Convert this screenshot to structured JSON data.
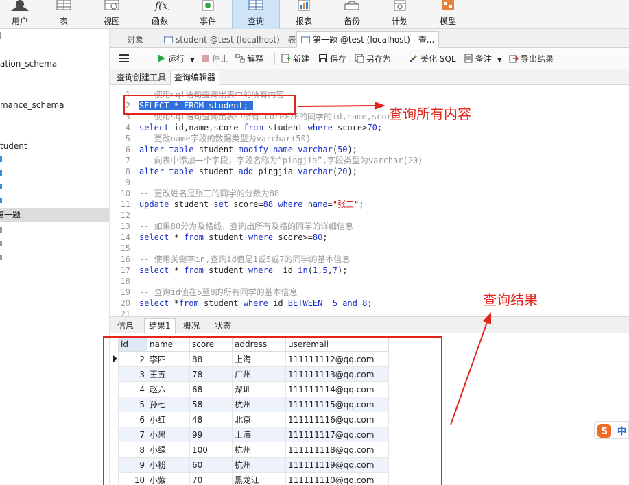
{
  "ribbon": {
    "items": [
      {
        "label": "用户",
        "icon": "user-icon"
      },
      {
        "label": "表",
        "icon": "table-icon"
      },
      {
        "label": "视图",
        "icon": "view-icon"
      },
      {
        "label": "函数",
        "icon": "function-icon"
      },
      {
        "label": "事件",
        "icon": "event-icon"
      },
      {
        "label": "查询",
        "icon": "query-icon",
        "active": true
      },
      {
        "label": "报表",
        "icon": "report-icon"
      },
      {
        "label": "备份",
        "icon": "backup-icon"
      },
      {
        "label": "计划",
        "icon": "schedule-icon"
      },
      {
        "label": "模型",
        "icon": "model-icon"
      }
    ]
  },
  "tree": {
    "items": [
      "ation_schema",
      "mance_schema",
      "tudent",
      "第一题"
    ]
  },
  "tabs": {
    "objects": "对象",
    "table_tab": "student @test (localhost) - 表",
    "query_tab": "第一题 @test (localhost) - 查..."
  },
  "toolbar": {
    "run": "运行",
    "stop": "停止",
    "explain": "解释",
    "new": "新建",
    "save": "保存",
    "save_as": "另存为",
    "beautify": "美化 SQL",
    "note": "备注",
    "export": "导出结果"
  },
  "subtabs": {
    "builder": "查询创建工具",
    "editor": "查询编辑器"
  },
  "editor": {
    "lines": [
      {
        "n": "1",
        "parts": [
          [
            "cm",
            "-- 使用sql语句查询出表中的所有内容"
          ]
        ]
      },
      {
        "n": "2",
        "parts": [
          [
            "hl",
            "SELECT * FROM student; "
          ]
        ]
      },
      {
        "n": "3",
        "parts": [
          [
            "cm",
            "-- 使用sql语句查询出表中所有score>70的同学的id,name,score"
          ]
        ]
      },
      {
        "n": "4",
        "parts": [
          [
            "kw",
            "select"
          ],
          [
            "",
            " id,name,score "
          ],
          [
            "kw",
            "from"
          ],
          [
            "",
            " student "
          ],
          [
            "kw",
            "where"
          ],
          [
            "",
            " score>"
          ],
          [
            "num",
            "70"
          ],
          [
            "",
            ";"
          ]
        ]
      },
      {
        "n": "5",
        "parts": [
          [
            "cm",
            "-- 更改name字段的数据类型为varchar(50)"
          ]
        ]
      },
      {
        "n": "6",
        "parts": [
          [
            "kw",
            "alter table"
          ],
          [
            "",
            " student "
          ],
          [
            "kw",
            "modify"
          ],
          [
            "",
            " "
          ],
          [
            "kw",
            "name"
          ],
          [
            "",
            " "
          ],
          [
            "kw",
            "varchar"
          ],
          [
            "",
            "("
          ],
          [
            "num",
            "50"
          ],
          [
            "",
            ");"
          ]
        ]
      },
      {
        "n": "7",
        "parts": [
          [
            "cm",
            "-- 向表中添加一个字段，字段名称为“pingjia”,字段类型为varchar(20)"
          ]
        ]
      },
      {
        "n": "8",
        "parts": [
          [
            "kw",
            "alter table"
          ],
          [
            "",
            " student "
          ],
          [
            "kw",
            "add"
          ],
          [
            "",
            " pingjia "
          ],
          [
            "kw",
            "varchar"
          ],
          [
            "",
            "("
          ],
          [
            "num",
            "20"
          ],
          [
            "",
            ");"
          ]
        ]
      },
      {
        "n": "9",
        "parts": []
      },
      {
        "n": "10",
        "parts": [
          [
            "cm",
            "-- 更改姓名是张三的同学的分数为88"
          ]
        ]
      },
      {
        "n": "11",
        "parts": [
          [
            "kw",
            "update"
          ],
          [
            "",
            " student "
          ],
          [
            "kw",
            "set"
          ],
          [
            "",
            " score="
          ],
          [
            "num",
            "88"
          ],
          [
            "",
            " "
          ],
          [
            "kw",
            "where"
          ],
          [
            "",
            " "
          ],
          [
            "kw",
            "name"
          ],
          [
            "",
            "="
          ],
          [
            "str",
            "\"张三\""
          ],
          [
            "",
            ";"
          ]
        ]
      },
      {
        "n": "12",
        "parts": []
      },
      {
        "n": "13",
        "parts": [
          [
            "cm",
            "-- 如果80分为及格线，查询出所有及格的同学的详细信息"
          ]
        ]
      },
      {
        "n": "14",
        "parts": [
          [
            "kw",
            "select"
          ],
          [
            "",
            " * "
          ],
          [
            "kw",
            "from"
          ],
          [
            "",
            " student "
          ],
          [
            "kw",
            "where"
          ],
          [
            "",
            " score>="
          ],
          [
            "num",
            "80"
          ],
          [
            "",
            ";"
          ]
        ]
      },
      {
        "n": "15",
        "parts": []
      },
      {
        "n": "16",
        "parts": [
          [
            "cm",
            "-- 使用关键字in,查询id值是1或5或7的同学的基本信息"
          ]
        ]
      },
      {
        "n": "17",
        "parts": [
          [
            "kw",
            "select"
          ],
          [
            "",
            " * "
          ],
          [
            "kw",
            "from"
          ],
          [
            "",
            " student "
          ],
          [
            "kw",
            "where"
          ],
          [
            "",
            "  id "
          ],
          [
            "kw",
            "in"
          ],
          [
            "",
            "("
          ],
          [
            "num",
            "1"
          ],
          [
            "",
            ","
          ],
          [
            "num",
            "5"
          ],
          [
            "",
            ","
          ],
          [
            "num",
            "7"
          ],
          [
            "",
            ");"
          ]
        ]
      },
      {
        "n": "18",
        "parts": []
      },
      {
        "n": "19",
        "parts": [
          [
            "cm",
            "-- 查询id值在5至8的所有同学的基本信息"
          ]
        ]
      },
      {
        "n": "20",
        "parts": [
          [
            "kw",
            "select"
          ],
          [
            "",
            " *"
          ],
          [
            "kw",
            "from"
          ],
          [
            "",
            " student "
          ],
          [
            "kw",
            "where"
          ],
          [
            "",
            " id "
          ],
          [
            "kw",
            "BETWEEN"
          ],
          [
            "",
            "  "
          ],
          [
            "num",
            "5"
          ],
          [
            "",
            " "
          ],
          [
            "kw",
            "and"
          ],
          [
            "",
            " "
          ],
          [
            "num",
            "8"
          ],
          [
            "",
            ";"
          ]
        ]
      },
      {
        "n": "21",
        "parts": []
      }
    ]
  },
  "result_tabs": {
    "info": "信息",
    "result1": "结果1",
    "overview": "概况",
    "status": "状态"
  },
  "grid": {
    "columns": [
      "id",
      "name",
      "score",
      "address",
      "useremail"
    ],
    "rows": [
      [
        "2",
        "李四",
        "88",
        "上海",
        "111111112@qq.com"
      ],
      [
        "3",
        "王五",
        "78",
        "广州",
        "111111113@qq.com"
      ],
      [
        "4",
        "赵六",
        "68",
        "深圳",
        "111111114@qq.com"
      ],
      [
        "5",
        "孙七",
        "58",
        "杭州",
        "111111115@qq.com"
      ],
      [
        "6",
        "小红",
        "48",
        "北京",
        "111111116@qq.com"
      ],
      [
        "7",
        "小黑",
        "99",
        "上海",
        "111111117@qq.com"
      ],
      [
        "8",
        "小绿",
        "100",
        "杭州",
        "111111118@qq.com"
      ],
      [
        "9",
        "小粉",
        "60",
        "杭州",
        "111111119@qq.com"
      ],
      [
        "10",
        "小紫",
        "70",
        "黑龙江",
        "111111110@qq.com"
      ]
    ]
  },
  "annotations": {
    "query_all": "查询所有内容",
    "query_result": "查询结果"
  },
  "ime": {
    "label": "中"
  },
  "colors": {
    "annotation_red": "#e4251b",
    "keyword_blue": "#1a2fc8",
    "selection_blue": "#2d6fdb",
    "active_ribbon": "#cfe4f7"
  }
}
